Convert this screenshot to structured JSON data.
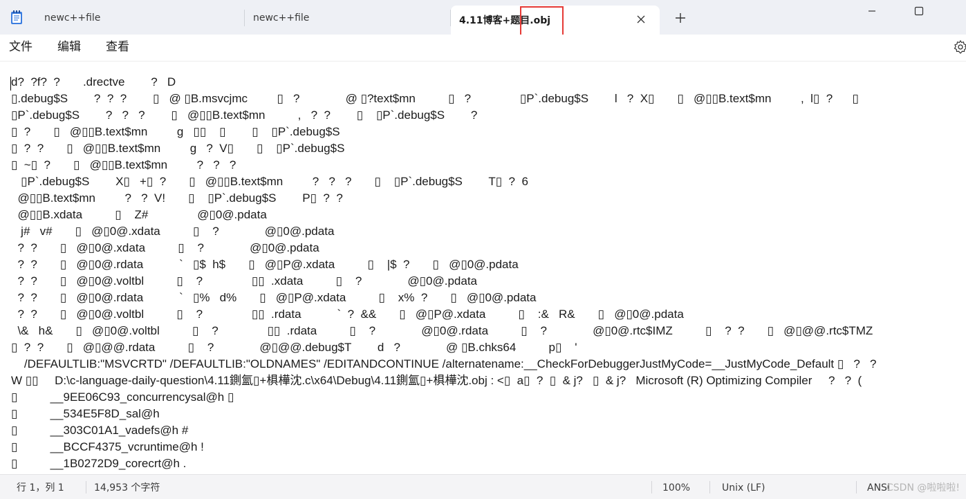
{
  "tabs": [
    {
      "label": "newc++file"
    },
    {
      "label": "newc++file"
    },
    {
      "label": "4.11博客+题目.obj"
    }
  ],
  "menu": {
    "file": "文件",
    "edit": "编辑",
    "view": "查看"
  },
  "icons": {
    "app": "notepad-icon",
    "close_tab": "close-icon",
    "new_tab": "plus-icon",
    "minimize": "minimize-icon",
    "maximize": "maximize-icon",
    "settings": "gear-icon"
  },
  "editor": {
    "lines": [
      "d?  ?f?  ?       .drectve        ?   D",
      "▯.debug$S        ?  ?  ?        ▯   @ ▯B.msvcjmc         ▯   ?              @ ▯?text$mn          ▯   ?               ▯P`.debug$S        l   ?  X▯       ▯   @▯▯B.text$mn         ,  l▯  ?      ▯",
      "▯P`.debug$S        ?   ?   ?        ▯   @▯▯B.text$mn          ,   ?  ?        ▯    ▯P`.debug$S        ?",
      "▯  ?       ▯   @▯▯B.text$mn         g   ▯▯    ▯        ▯    ▯P`.debug$S",
      "▯  ?  ?       ▯   @▯▯B.text$mn         g   ?  V▯       ▯    ▯P`.debug$S",
      "▯  ~▯  ?       ▯   @▯▯B.text$mn         ?   ?   ?",
      "   ▯P`.debug$S        X▯   +▯  ?       ▯   @▯▯B.text$mn         ?   ?   ?       ▯    ▯P`.debug$S        T▯  ?  6",
      "  @▯▯B.text$mn         ?   ?  V!       ▯    ▯P`.debug$S        P▯  ?  ?",
      "  @▯▯B.xdata          ▯    Z#               @▯0@.pdata",
      "   j#   v#       ▯   @▯0@.xdata          ▯    ?              @▯0@.pdata",
      "  ?  ?       ▯   @▯0@.xdata          ▯    ?              @▯0@.pdata",
      "  ?  ?       ▯   @▯0@.rdata           `   ▯$  h$       ▯   @▯P@.xdata          ▯    |$  ?       ▯   @▯0@.pdata",
      "  ?  ?       ▯   @▯0@.voltbl          ▯    ?               ▯▯  .xdata          ▯    ?              @▯0@.pdata",
      "  ?  ?       ▯   @▯0@.rdata           `   ▯%   d%       ▯   @▯P@.xdata          ▯    x%  ?       ▯   @▯0@.pdata",
      "  ?  ?       ▯   @▯0@.voltbl          ▯    ?               ▯▯  .rdata           `  ?  &&       ▯   @▯P@.xdata          ▯    :&   R&       ▯   @▯0@.pdata",
      "  \\&   h&       ▯   @▯0@.voltbl          ▯    ?               ▯▯  .rdata          ▯    ?              @▯0@.rdata          ▯    ?              @▯0@.rtc$IMZ          ▯    ?  ?       ▯   @▯@@.rtc$TMZ",
      "▯  ?  ?       ▯   @▯@@.rdata          ▯    ?              @▯@@.debug$T        d   ?              @ ▯B.chks64          p▯    '",
      "    /DEFAULTLIB:\"MSVCRTD\" /DEFAULTLIB:\"OLDNAMES\" /EDITANDCONTINUE /alternatename:__CheckForDebuggerJustMyCode=__JustMyCode_Default ▯   ?   ?",
      "W ▯▯     D:\\c-language-daily-question\\4.11鍘氳▯+椇樺沈.c\\x64\\Debug\\4.11鍘氳▯+椇樺沈.obj : <▯  a▯  ?  ▯  & j?   ▯  & j?   Microsoft (R) Optimizing Compiler     ?   ?  (",
      "▯          __9EE06C93_concurrencysal@h ▯",
      "▯          __534E5F8D_sal@h",
      "▯          __303C01A1_vadefs@h #",
      "▯          __BCCF4375_vcruntime@h !",
      "▯          __1B0272D9_corecrt@h ."
    ]
  },
  "status": {
    "position": "行 1，列 1",
    "chars": "14,953 个字符",
    "zoom": "100%",
    "line_ending": "Unix (LF)",
    "encoding": "ANSI",
    "watermark": "CSDN @啦啦啦!"
  },
  "colors": {
    "highlight_box": "#e53935",
    "tab_bar": "#eef0f5"
  }
}
